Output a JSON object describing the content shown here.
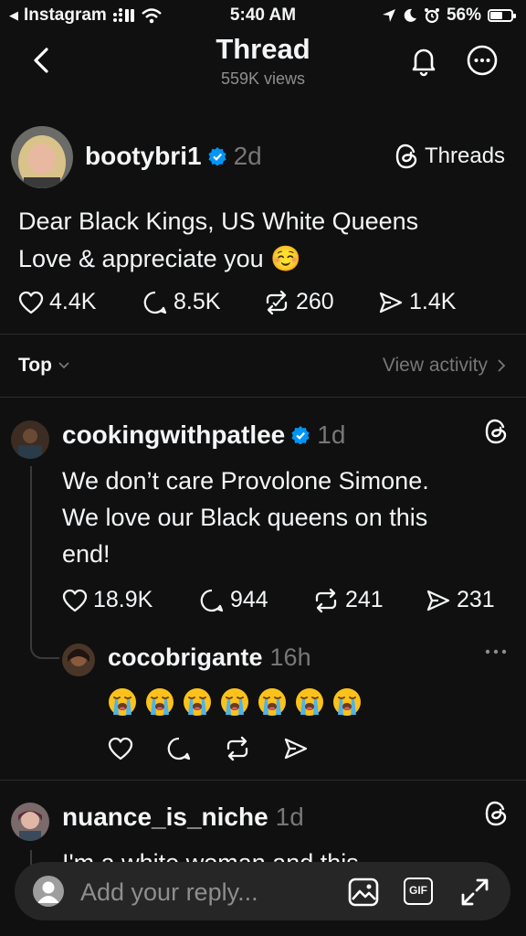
{
  "status_bar": {
    "back_app": "Instagram",
    "time": "5:40 AM",
    "battery": "56%"
  },
  "header": {
    "title": "Thread",
    "subtitle": "559K views"
  },
  "root_post": {
    "username": "bootybri1",
    "time": "2d",
    "badge_label": "Threads",
    "text_line1": "Dear Black Kings, US White Queens",
    "text_line2": "Love & appreciate you ☺️",
    "likes": "4.4K",
    "comments": "8.5K",
    "reposts": "260",
    "shares": "1.4K"
  },
  "sort": {
    "label": "Top",
    "view_activity": "View activity"
  },
  "replies": [
    {
      "username": "cookingwithpatlee",
      "time": "1d",
      "text_line1": "We don’t care Provolone Simone.",
      "text_line2": "We love our Black queens on this",
      "text_line3": "end!",
      "likes": "18.9K",
      "comments": "944",
      "reposts": "241",
      "shares": "231"
    },
    {
      "username": "cocobrigante",
      "time": "16h",
      "emoji": "😭😭😭😭😭😭😭",
      "emoji_count": 7
    },
    {
      "username": "nuance_is_niche",
      "time": "1d",
      "text_partial": "I'm a white woman and this"
    }
  ],
  "reply_bar": {
    "placeholder": "Add your reply...",
    "gif_label": "GIF"
  },
  "colors": {
    "background": "#101010",
    "text": "#f3f5f7",
    "secondary": "#777777",
    "verified": "#0095f6",
    "reply_bar": "#262626"
  }
}
